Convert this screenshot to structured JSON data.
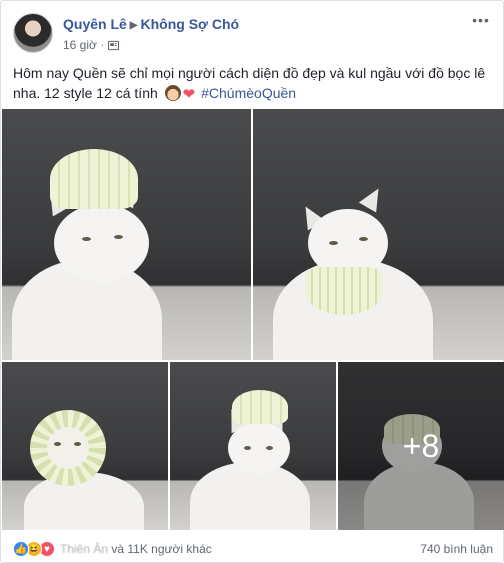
{
  "post": {
    "author": "Quyên Lê",
    "group": "Không Sợ Chó",
    "time": "16 giờ",
    "separator": "·",
    "body_text": "Hôm nay Quền sẽ chỉ mọi người cách diện đồ đẹp và kul ngầu với đồ bọc lê nha. 12 style 12 cá tính",
    "hashtag": "#ChúmèoQuền",
    "more_count": "+8"
  },
  "footer": {
    "likers_blurred": "Thiên Ân",
    "likers_rest": " và 11K người khác",
    "comments": "740 bình luận"
  },
  "colors": {
    "link": "#385898",
    "muted": "#606770",
    "like_blue": "#2d88ff",
    "love_red": "#f25268",
    "haha_yellow": "#f7b125"
  },
  "icons": [
    "play-arrow-icon",
    "globe-privacy-icon",
    "more-options-icon",
    "like-reaction-icon",
    "haha-reaction-icon",
    "love-reaction-icon",
    "heart-emoji-icon",
    "woman-emoji-icon"
  ]
}
